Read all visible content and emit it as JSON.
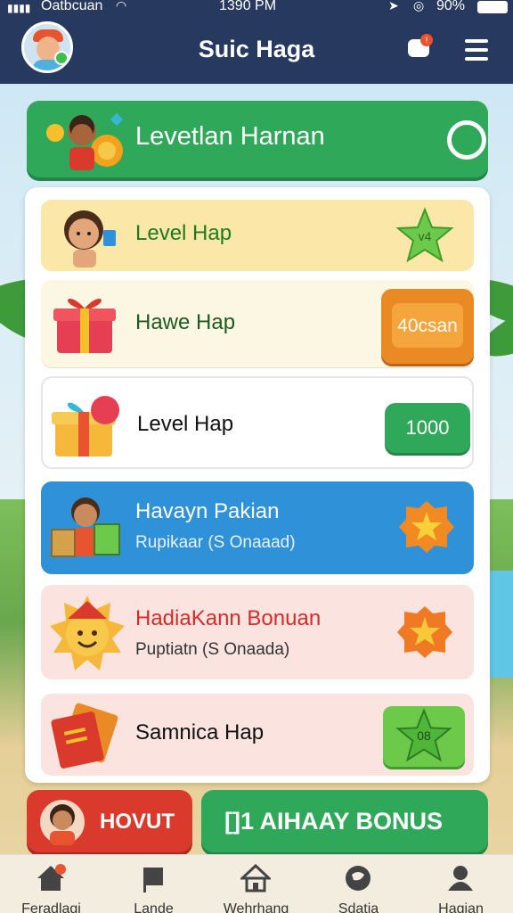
{
  "statusbar": {
    "carrier": "Oatbcuan",
    "time": "1390 PM",
    "battery": "90%"
  },
  "header": {
    "title": "Suic Haga"
  },
  "daily": {
    "label": "Levetlan Harnan"
  },
  "rows": [
    {
      "title": "Level Hap",
      "subtitle": "",
      "reward": "v4"
    },
    {
      "title": "Hawe Hap",
      "subtitle": "",
      "reward": "40csan"
    },
    {
      "title": "Level Hap",
      "subtitle": "",
      "reward": "1000"
    },
    {
      "title": "Havayn Pakian",
      "subtitle": "Rupikaar (S Onaaad)",
      "reward": ""
    },
    {
      "title": "HadiaKann Bonuan",
      "subtitle": "Puptiatn (S Onaada)",
      "reward": ""
    },
    {
      "title": "Samnica Hap",
      "subtitle": "",
      "reward": "08"
    }
  ],
  "buttons": {
    "hovut": "HOVUT",
    "bonus": "[]1 AIHAAY BONUS"
  },
  "tabs": [
    {
      "label": "Feradlagi",
      "icon": "home-icon"
    },
    {
      "label": "Lande",
      "icon": "flag-icon"
    },
    {
      "label": "Wehrhang",
      "icon": "house-icon"
    },
    {
      "label": "Sdatia",
      "icon": "globe-icon"
    },
    {
      "label": "Hagian",
      "icon": "user-icon"
    }
  ],
  "colors": {
    "header": "#27395e",
    "green": "#2fa859",
    "orange": "#e98a24",
    "blue": "#2f91d8",
    "red": "#d93a2c",
    "yellow": "#fbe8a8"
  }
}
